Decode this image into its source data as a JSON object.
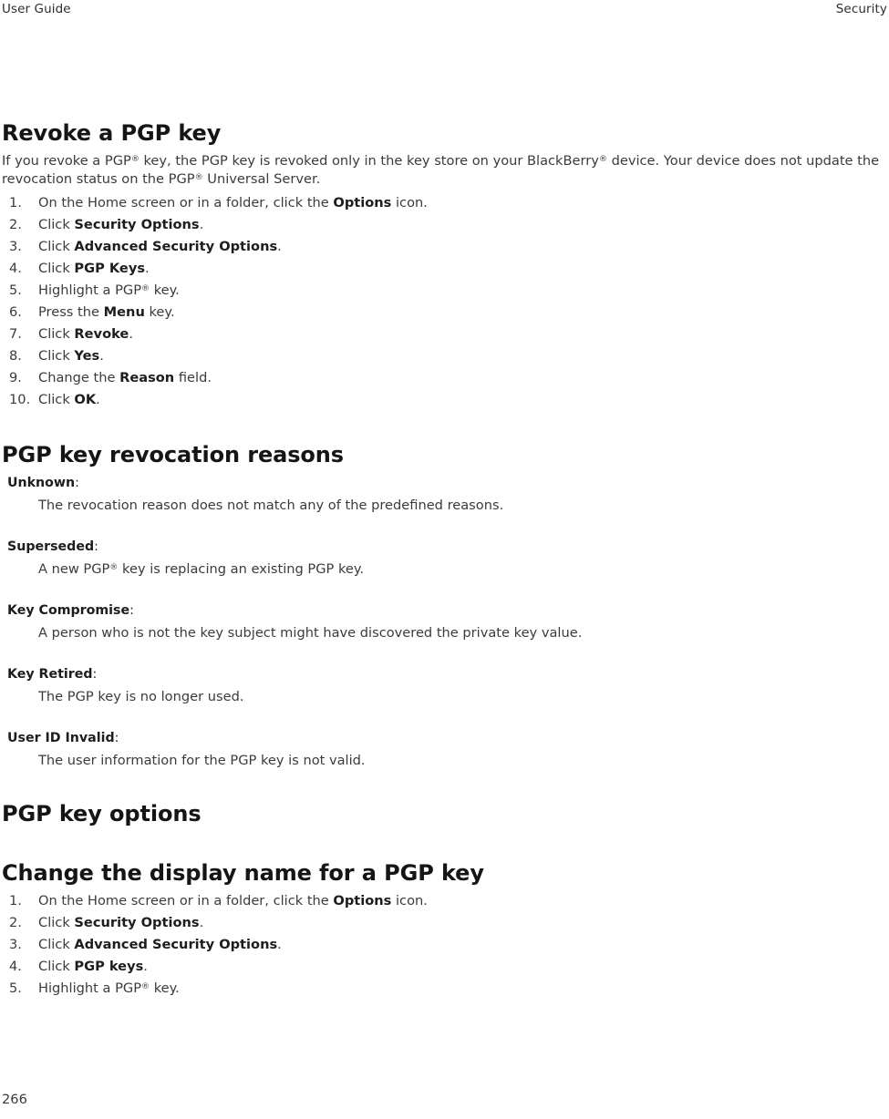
{
  "running_header": {
    "left": "User Guide",
    "right": "Security"
  },
  "section_revoke": {
    "title": "Revoke a PGP key",
    "intro": "If you revoke a PGP® key, the PGP key is revoked only in the key store on your BlackBerry® device. Your device does not update the revocation status on the PGP® Universal Server.",
    "steps": [
      {
        "prefix": "On the Home screen or in a folder, click the ",
        "bold": "Options",
        "suffix": " icon."
      },
      {
        "prefix": "Click ",
        "bold": "Security Options",
        "suffix": "."
      },
      {
        "prefix": "Click ",
        "bold": "Advanced Security Options",
        "suffix": "."
      },
      {
        "prefix": "Click ",
        "bold": "PGP Keys",
        "suffix": "."
      },
      {
        "prefix": "Highlight a PGP® key.",
        "bold": "",
        "suffix": ""
      },
      {
        "prefix": "Press the ",
        "bold": "Menu",
        "suffix": " key."
      },
      {
        "prefix": "Click ",
        "bold": "Revoke",
        "suffix": "."
      },
      {
        "prefix": "Click ",
        "bold": "Yes",
        "suffix": "."
      },
      {
        "prefix": "Change the ",
        "bold": "Reason",
        "suffix": " field."
      },
      {
        "prefix": "Click ",
        "bold": "OK",
        "suffix": "."
      }
    ]
  },
  "section_reasons": {
    "title": "PGP key revocation reasons",
    "definitions": [
      {
        "term": "Unknown",
        "description": "The revocation reason does not match any of the predefined reasons."
      },
      {
        "term": "Superseded",
        "description": "A new PGP® key is replacing an existing PGP key."
      },
      {
        "term": "Key Compromise",
        "description": "A person who is not the key subject might have discovered the private key value."
      },
      {
        "term": "Key Retired",
        "description": "The PGP key is no longer used."
      },
      {
        "term": "User ID Invalid",
        "description": "The user information for the PGP key is not valid."
      }
    ]
  },
  "section_options": {
    "title": "PGP key options"
  },
  "section_display_name": {
    "title": "Change the display name for a PGP key",
    "steps": [
      {
        "prefix": "On the Home screen or in a folder, click the ",
        "bold": "Options",
        "suffix": " icon."
      },
      {
        "prefix": "Click ",
        "bold": "Security Options",
        "suffix": "."
      },
      {
        "prefix": "Click ",
        "bold": "Advanced Security Options",
        "suffix": "."
      },
      {
        "prefix": "Click ",
        "bold": "PGP keys",
        "suffix": "."
      },
      {
        "prefix": "Highlight a PGP® key.",
        "bold": "",
        "suffix": ""
      }
    ]
  },
  "footer": {
    "page_number": "266"
  }
}
